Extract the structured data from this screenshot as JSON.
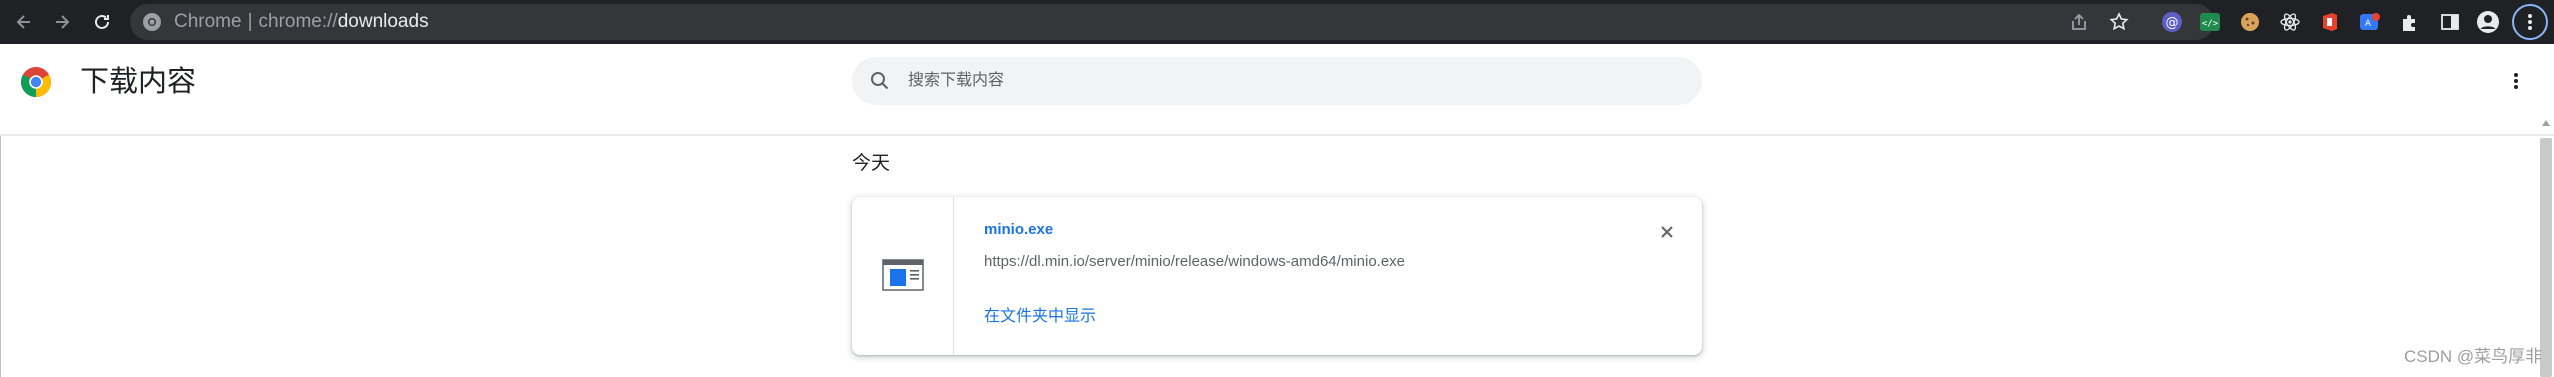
{
  "toolbar": {
    "url_prefix": "Chrome",
    "url_separator": "|",
    "url_scheme": "chrome://",
    "url_host": "downloads"
  },
  "page": {
    "title": "下载内容",
    "search_placeholder": "搜索下载内容"
  },
  "downloads": {
    "date_header": "今天",
    "items": [
      {
        "file_name": "minio.exe",
        "url": "https://dl.min.io/server/minio/release/windows-amd64/minio.exe",
        "show_in_folder_label": "在文件夹中显示"
      }
    ]
  },
  "watermark": "CSDN @菜鸟厚非",
  "colors": {
    "toolbar_bg": "#202124",
    "omnibox_bg": "#35363a",
    "link_blue": "#1a73e8",
    "search_bg": "#f1f3f4"
  }
}
